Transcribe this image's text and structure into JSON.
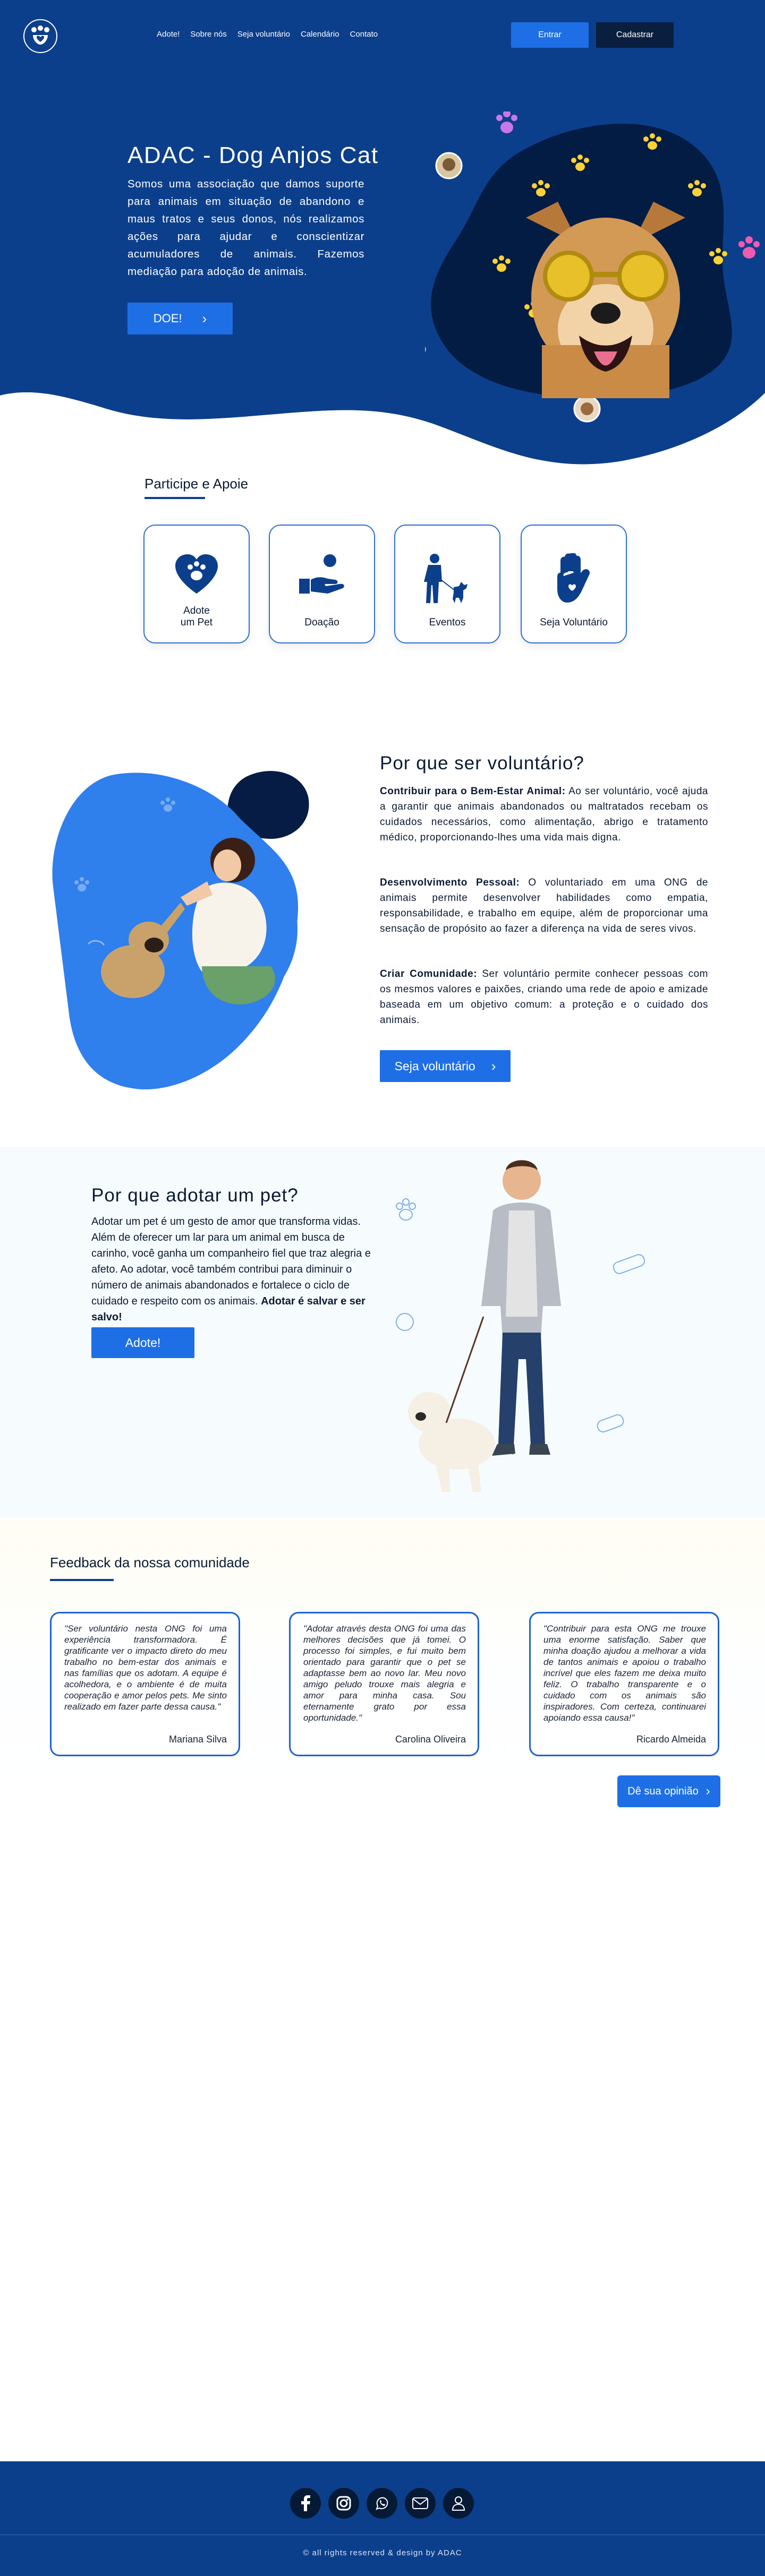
{
  "nav": {
    "links": [
      "Adote!",
      "Sobre nós",
      "Seja voluntário",
      "Calendário",
      "Contato"
    ],
    "login_label": "Entrar",
    "signup_label": "Cadastrar"
  },
  "hero": {
    "title": "ADAC - Dog Anjos Cat",
    "text": "Somos uma associação que damos suporte para animais em situação de abandono e maus tratos e seus donos, nós realizamos ações para ajudar e conscientizar acumuladores de animais. Fazemos mediação para adoção de animais.",
    "cta_label": "DOE!",
    "chevron": "›"
  },
  "participe": {
    "title": "Participe e Apoie",
    "cards": [
      {
        "label": "Adote\num Pet",
        "icon": "heart-paw-icon"
      },
      {
        "label": "Doação",
        "icon": "donation-hand-icon"
      },
      {
        "label": "Eventos",
        "icon": "person-dog-icon"
      },
      {
        "label": "Seja Voluntário",
        "icon": "hand-heart-icon"
      }
    ]
  },
  "volunteer": {
    "title": "Por que ser voluntário?",
    "items": [
      {
        "heading": "Contribuir para o Bem-Estar Animal:",
        "text": " Ao ser voluntário, você ajuda a garantir que animais abandonados ou maltratados recebam os cuidados necessários, como alimentação, abrigo e tratamento médico, proporcionando-lhes uma vida mais digna."
      },
      {
        "heading": "Desenvolvimento Pessoal:",
        "text": " O voluntariado em uma ONG de animais permite desenvolver habilidades como empatia, responsabilidade, e trabalho em equipe, além de proporcionar uma sensação de propósito ao fazer a diferença na vida de seres vivos."
      },
      {
        "heading": "Criar Comunidade:",
        "text": " Ser voluntário permite conhecer pessoas com os mesmos valores e paixões, criando uma rede de apoio e amizade baseada em um objetivo comum: a proteção e o cuidado dos animais."
      }
    ],
    "cta_label": "Seja voluntário",
    "chevron": "›"
  },
  "adopt": {
    "title": "Por que adotar um pet?",
    "text": "Adotar um pet é um gesto de amor que transforma vidas. Além de oferecer um lar para um animal em busca de carinho, você ganha um companheiro fiel que traz alegria e afeto. Ao adotar, você também contribui para diminuir o número de animais abandonados e fortalece o ciclo de cuidado e respeito com os animais.",
    "bold_text": "Adotar é salvar e ser salvo!",
    "cta_label": "Adote!"
  },
  "feedback": {
    "title": "Feedback da nossa comunidade",
    "items": [
      {
        "quote": "\"Ser voluntário nesta ONG foi uma experiência transformadora. É gratificante ver o impacto direto do meu trabalho no bem-estar dos animais e nas famílias que os adotam. A equipe é acolhedora, e o ambiente é de muita cooperação e amor pelos pets. Me sinto realizado em fazer parte dessa causa.\"",
        "author": "Mariana Silva"
      },
      {
        "quote": "\"Adotar através desta ONG foi uma das melhores decisões que já tomei. O processo foi simples, e fui muito bem orientado para garantir que o pet se adaptasse bem ao novo lar. Meu novo amigo peludo trouxe mais alegria e amor para minha casa. Sou eternamente grato por essa oportunidade.\"",
        "author": "Carolina Oliveira"
      },
      {
        "quote": "\"Contribuir para esta ONG me trouxe uma enorme satisfação. Saber que minha doação ajudou a melhorar a vida de tantos animais e apoiou o trabalho incrível que eles fazem me deixa muito feliz. O trabalho transparente e o cuidado com os animais são inspiradores. Com certeza, continuarei apoiando essa causa!\"",
        "author": "Ricardo Almeida"
      }
    ],
    "cta_label": "Dê sua opinião",
    "chevron": "›"
  },
  "footer": {
    "social_icons": [
      "facebook-icon",
      "instagram-icon",
      "whatsapp-icon",
      "email-icon",
      "user-icon"
    ],
    "copyright": "© all rights reserved &  design by ADAC"
  },
  "colors": {
    "navy": "#0c3f8b",
    "accent": "#1e6fe6",
    "dark": "#0a1e3f"
  }
}
